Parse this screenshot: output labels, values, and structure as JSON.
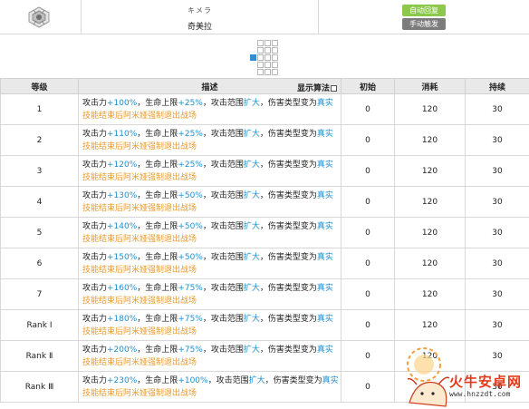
{
  "header": {
    "name_jp": "キメラ",
    "name_cn": "奇美拉",
    "tag_auto": "自动回复",
    "tag_manual": "手动触发",
    "icon": "chimera-skill-icon"
  },
  "range_grid": {
    "cols": 3,
    "rows": 5,
    "self_cell": [
      0,
      2
    ]
  },
  "table": {
    "headers": {
      "level": "等级",
      "desc": "描述",
      "show_algo": "显示算法",
      "initial": "初始",
      "cost": "消耗",
      "duration": "持续"
    },
    "rows": [
      {
        "level": "1",
        "atk": "+100%",
        "hp": "+25%",
        "initial": "0",
        "cost": "120",
        "duration": "30"
      },
      {
        "level": "2",
        "atk": "+110%",
        "hp": "+25%",
        "initial": "0",
        "cost": "120",
        "duration": "30"
      },
      {
        "level": "3",
        "atk": "+120%",
        "hp": "+25%",
        "initial": "0",
        "cost": "120",
        "duration": "30"
      },
      {
        "level": "4",
        "atk": "+130%",
        "hp": "+50%",
        "initial": "0",
        "cost": "120",
        "duration": "30"
      },
      {
        "level": "5",
        "atk": "+140%",
        "hp": "+50%",
        "initial": "0",
        "cost": "120",
        "duration": "30"
      },
      {
        "level": "6",
        "atk": "+150%",
        "hp": "+50%",
        "initial": "0",
        "cost": "120",
        "duration": "30"
      },
      {
        "level": "7",
        "atk": "+160%",
        "hp": "+75%",
        "initial": "0",
        "cost": "120",
        "duration": "30"
      },
      {
        "level": "Rank Ⅰ",
        "atk": "+180%",
        "hp": "+75%",
        "initial": "0",
        "cost": "120",
        "duration": "30"
      },
      {
        "level": "Rank Ⅱ",
        "atk": "+200%",
        "hp": "+75%",
        "initial": "0",
        "cost": "120",
        "duration": "30"
      },
      {
        "level": "Rank Ⅲ",
        "atk": "+230%",
        "hp": "+100%",
        "initial": "0",
        "cost": "120",
        "duration": "30"
      }
    ],
    "desc_parts": {
      "atk_label": "攻击力",
      "sep1": "，生命上限",
      "sep2": "，攻击范围",
      "range_word": "扩大",
      "sep3": "，伤害类型变为",
      "true_word": "真实",
      "line2": "技能结束后阿米娅强制退出战场"
    }
  },
  "colors": {
    "highlight_blue": "#1f8fd0",
    "highlight_orange": "#e99a2b",
    "tag_auto": "#8cc84b",
    "tag_manual": "#7c7c7c"
  },
  "watermark": {
    "text": "火牛安卓网",
    "url": "www.hnzzdt.com"
  }
}
